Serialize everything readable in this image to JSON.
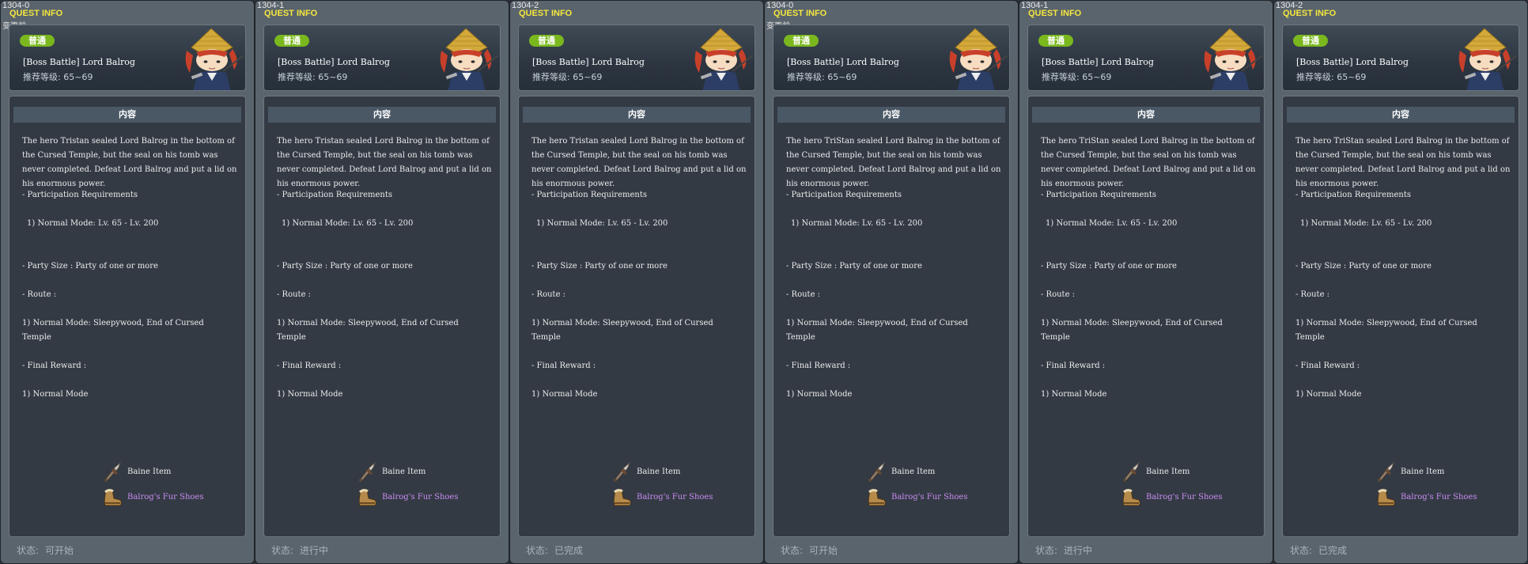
{
  "common": {
    "title": "QUEST INFO",
    "note": "变更前",
    "badge": "普通",
    "quest_name": "[Boss Battle] Lord Balrog",
    "level_label": "推荐等级:",
    "level_range": "65~69",
    "section_title": "内容",
    "participation": "- Participation Requirements",
    "normal_mode_level": "1) Normal Mode: Lv. 65 - Lv. 200",
    "party_size": "- Party Size : Party of one or more",
    "route": "- Route :",
    "route_detail": "1) Normal Mode: Sleepywood, End of Cursed Temple",
    "final_reward": "- Final Reward :",
    "reward_mode": "1) Normal Mode",
    "reward_1": "Baine Item",
    "reward_2": "Balrog's Fur Shoes",
    "status_label": "状态:"
  },
  "desc_tristan": "The hero Tristan sealed Lord Balrog in the bottom of the Cursed Temple, but the seal on his tomb was never completed. Defeat Lord Balrog and put a lid on his enormous power.",
  "desc_tristan_cap": "The hero TriStan sealed Lord Balrog in the bottom of the Cursed Temple, but the seal on his tomb was never completed. Defeat Lord Balrog and put a lid on his enormous power.",
  "panels": [
    {
      "id": "1304-0",
      "desc": "The hero Tristan sealed Lord Balrog in the bottom of the Cursed Temple, but the seal on his tomb was never completed. Defeat Lord Balrog and put a lid on his enormous power.",
      "status": "可开始",
      "show_note": true
    },
    {
      "id": "1304-1",
      "desc": "The hero Tristan sealed Lord Balrog in the bottom of the Cursed Temple, but the seal on his tomb was never completed. Defeat Lord Balrog and put a lid on his enormous power.",
      "status": "进行中",
      "show_note": false
    },
    {
      "id": "1304-2",
      "desc": "The hero Tristan sealed Lord Balrog in the bottom of the Cursed Temple, but the seal on his tomb was never completed. Defeat Lord Balrog and put a lid on his enormous power.",
      "status": "已完成",
      "show_note": false
    },
    {
      "id": "1304-0",
      "desc": "The hero TriStan sealed Lord Balrog in the bottom of the Cursed Temple, but the seal on his tomb was never completed. Defeat Lord Balrog and put a lid on his enormous power.",
      "status": "可开始",
      "show_note": true
    },
    {
      "id": "1304-1",
      "desc": "The hero TriStan sealed Lord Balrog in the bottom of the Cursed Temple, but the seal on his tomb was never completed. Defeat Lord Balrog and put a lid on his enormous power.",
      "status": "进行中",
      "show_note": false
    },
    {
      "id": "1304-2",
      "desc": "The hero TriStan sealed Lord Balrog in the bottom of the Cursed Temple, but the seal on his tomb was never completed. Defeat Lord Balrog and put a lid on his enormous power.",
      "status": "已完成",
      "show_note": false
    }
  ],
  "colors": {
    "title": "#f4e640",
    "badge": "#7ab81e",
    "reward_highlight": "#c98cf0"
  },
  "icons": {
    "npc": "npc-portrait-icon",
    "reward_1": "dagger-icon",
    "reward_2": "fur-shoes-icon"
  }
}
